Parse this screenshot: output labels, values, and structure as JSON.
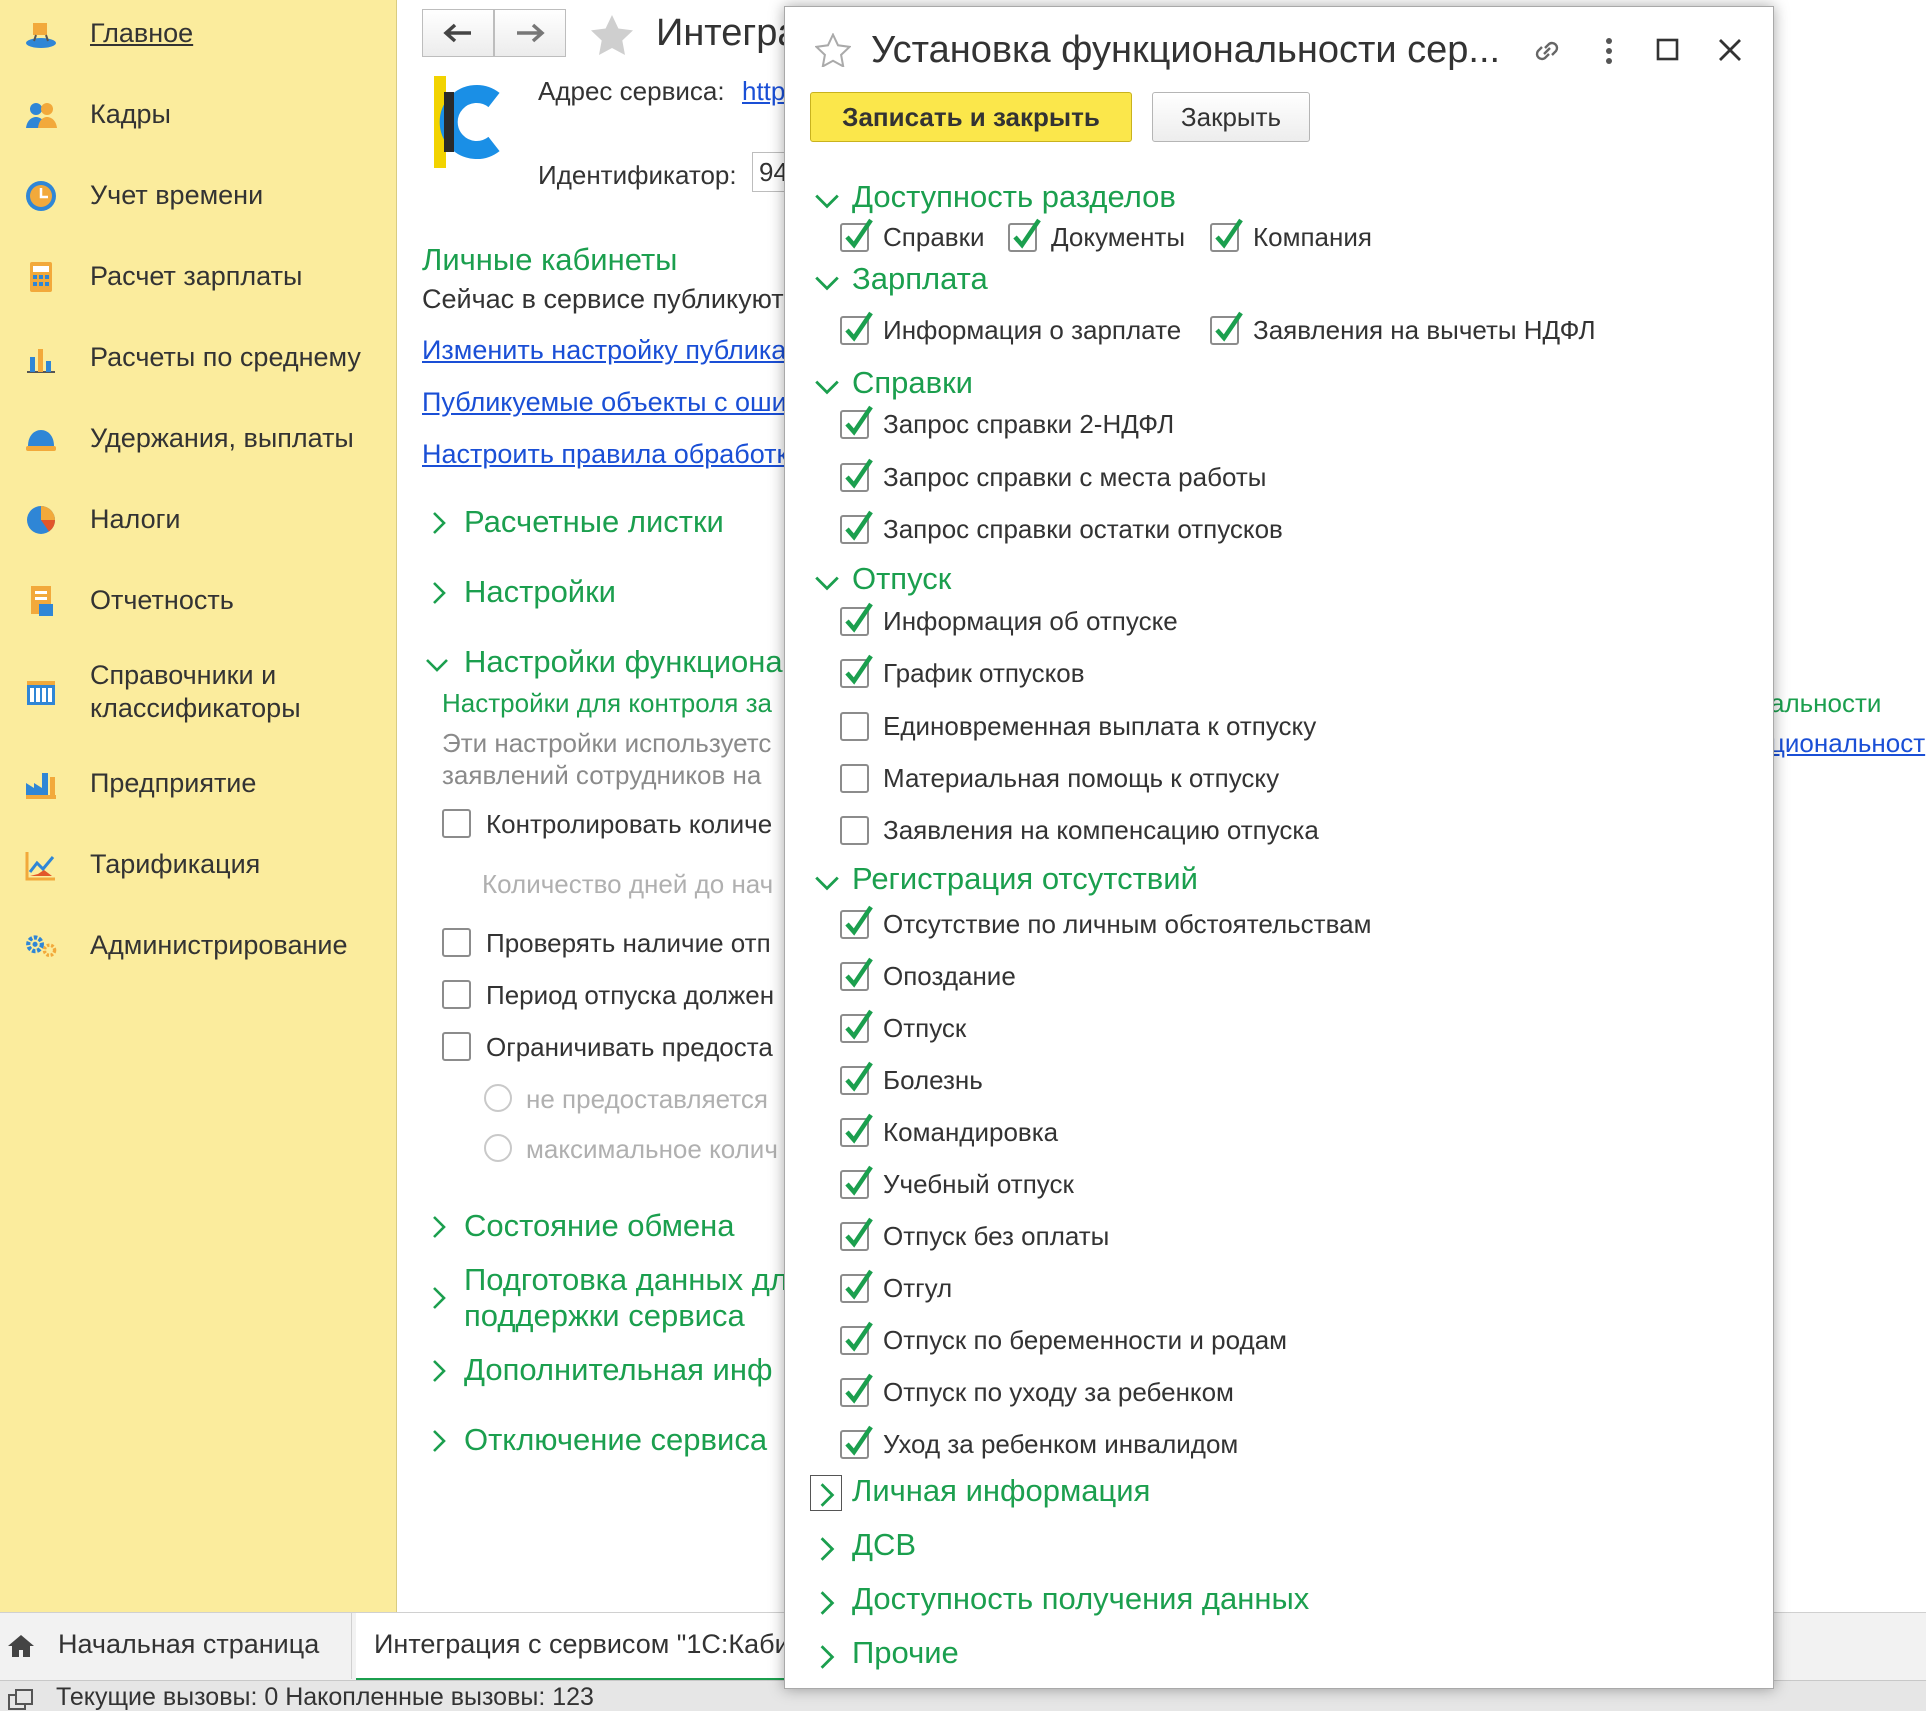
{
  "sidebar": {
    "items": [
      {
        "label": "Главное",
        "icon": "home-desk-icon"
      },
      {
        "label": "Кадры",
        "icon": "people-icon"
      },
      {
        "label": "Учет времени",
        "icon": "clock-icon"
      },
      {
        "label": "Расчет зарплаты",
        "icon": "calculator-icon"
      },
      {
        "label": "Расчеты по среднему",
        "icon": "bar-chart-icon"
      },
      {
        "label": "Удержания, выплаты",
        "icon": "hat-icon"
      },
      {
        "label": "Налоги",
        "icon": "pie-chart-icon"
      },
      {
        "label": "Отчетность",
        "icon": "report-icon"
      },
      {
        "label": "Справочники и\nклассификаторы",
        "icon": "books-icon"
      },
      {
        "label": "Предприятие",
        "icon": "factory-icon"
      },
      {
        "label": "Тарификация",
        "icon": "line-chart-icon"
      },
      {
        "label": "Администрирование",
        "icon": "gears-icon"
      }
    ]
  },
  "main": {
    "title": "Интегра",
    "service_address_label": "Адрес сервиса:",
    "service_address_value": "http",
    "identifier_label": "Идентификатор:",
    "identifier_value": "94",
    "personal_cabinets_title": "Личные кабинеты",
    "publish_text": "Сейчас в сервисе публикуют",
    "links": [
      "Изменить настройку публика",
      "Публикуемые объекты с оши",
      "Настроить правила обработк"
    ],
    "section_payslips": "Расчетные листки",
    "section_settings": "Настройки",
    "section_func_settings": "Настройки функциона",
    "control_settings_text": "Настройки для контроля за",
    "settings_used_text_1": "Эти настройки используетс",
    "settings_used_text_2": "заявлений сотрудников на",
    "right_green_text": "альности",
    "right_link_text": "циональност",
    "checkbox_control_count": "Контролировать количе",
    "days_count_label": "Количество дней до нач",
    "checkbox_check_presence": "Проверять наличие отп",
    "checkbox_period": "Период отпуска должен",
    "checkbox_limit": "Ограничивать предоста",
    "radio_not_provided": "не предоставляется",
    "radio_max": "максимальное колич",
    "section_exchange": "Состояние обмена",
    "section_prepare_1": "Подготовка данных дл",
    "section_prepare_2": "поддержки сервиса",
    "section_additional": "Дополнительная инф",
    "section_disable": "Отключение сервиса"
  },
  "dialog": {
    "title": "Установка функциональности сер...",
    "save_close_label": "Записать и закрыть",
    "close_label": "Закрыть",
    "sections": [
      {
        "title": "Доступность разделов",
        "expanded": true,
        "inline": true,
        "items": [
          {
            "label": "Справки",
            "checked": true
          },
          {
            "label": "Документы",
            "checked": true
          },
          {
            "label": "Компания",
            "checked": true
          }
        ]
      },
      {
        "title": "Зарплата",
        "expanded": true,
        "inline": true,
        "items": [
          {
            "label": "Информация о зарплате",
            "checked": true
          },
          {
            "label": "Заявления на вычеты НДФЛ",
            "checked": true
          }
        ]
      },
      {
        "title": "Справки",
        "expanded": true,
        "items": [
          {
            "label": "Запрос справки 2-НДФЛ",
            "checked": true
          },
          {
            "label": "Запрос справки с места работы",
            "checked": true
          },
          {
            "label": "Запрос справки остатки отпусков",
            "checked": true
          }
        ]
      },
      {
        "title": "Отпуск",
        "expanded": true,
        "items": [
          {
            "label": "Информация об отпуске",
            "checked": true
          },
          {
            "label": "График отпусков",
            "checked": true
          },
          {
            "label": "Единовременная выплата к отпуску",
            "checked": false
          },
          {
            "label": "Материальная помощь к отпуску",
            "checked": false
          },
          {
            "label": "Заявления на компенсацию отпуска",
            "checked": false
          }
        ]
      },
      {
        "title": "Регистрация отсутствий",
        "expanded": true,
        "items": [
          {
            "label": "Отсутствие по личным обстоятельствам",
            "checked": true
          },
          {
            "label": "Опоздание",
            "checked": true
          },
          {
            "label": "Отпуск",
            "checked": true
          },
          {
            "label": "Болезнь",
            "checked": true
          },
          {
            "label": "Командировка",
            "checked": true
          },
          {
            "label": "Учебный отпуск",
            "checked": true
          },
          {
            "label": "Отпуск без оплаты",
            "checked": true
          },
          {
            "label": "Отгул",
            "checked": true
          },
          {
            "label": "Отпуск по беременности и родам",
            "checked": true
          },
          {
            "label": "Отпуск по уходу за ребенком",
            "checked": true
          },
          {
            "label": "Уход за ребенком инвалидом",
            "checked": true
          }
        ]
      },
      {
        "title": "Личная информация",
        "expanded": false,
        "focused": true
      },
      {
        "title": "ДСВ",
        "expanded": false
      },
      {
        "title": "Доступность получения данных",
        "expanded": false
      },
      {
        "title": "Прочие",
        "expanded": false
      }
    ]
  },
  "tabs": {
    "home": "Начальная страница",
    "active": "Интеграция с сервисом \"1С:Каби"
  },
  "status": {
    "text": "Текущие вызовы: 0   Накопленные вызовы: 123"
  },
  "colors": {
    "sidebar_bg": "#FBEC9D",
    "accent_green": "#1B9F4E",
    "primary_button": "#FBE74B",
    "link_blue": "#1a4fd6"
  }
}
